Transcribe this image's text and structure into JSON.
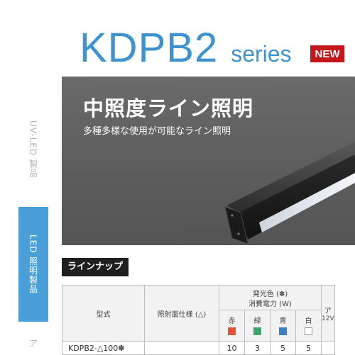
{
  "header": {
    "model": "KDPB2",
    "series": "series",
    "badge": "NEW"
  },
  "side_nav": {
    "items": [
      {
        "label": "UV-LED 製品",
        "active": false
      },
      {
        "label": "LED 照明製品",
        "active": true
      },
      {
        "label": "ア",
        "active": false
      }
    ]
  },
  "hero": {
    "heading": "中照度ライン照明",
    "subheading": "多種多様な使用が可能なライン照明"
  },
  "section": {
    "heading": "ラインナップ"
  },
  "table": {
    "headers": {
      "model": "型式",
      "face": "照射面仕様 (△)",
      "emit_line1": "発光色 (✽)",
      "emit_line2": "消費電力 (W)",
      "extra": "ア",
      "voltage": "12V"
    },
    "colors": [
      {
        "name": "赤",
        "hex": "#e2533a"
      },
      {
        "name": "緑",
        "hex": "#3aa86b"
      },
      {
        "name": "青",
        "hex": "#3b82c4"
      },
      {
        "name": "白",
        "hex": "#ffffff"
      }
    ],
    "rows": [
      {
        "model": "KDPB2-△100✽",
        "face": "",
        "red": "10",
        "green": "3",
        "blue": "5",
        "white": "5"
      }
    ]
  },
  "colors": {
    "accent": "#3d93cf",
    "badge": "#c3161c",
    "nav_active": "#4a9fd8",
    "hero_bg": "#5f5f5f"
  }
}
